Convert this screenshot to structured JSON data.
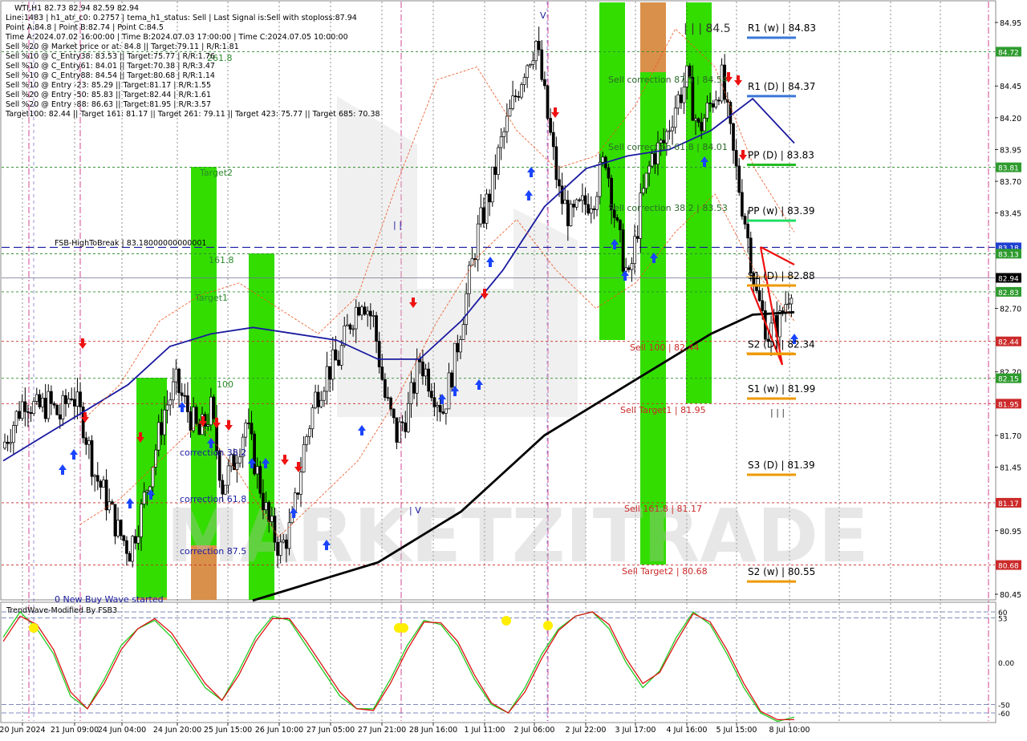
{
  "header": {
    "symbol": "WTI,H1  82.73 82.94 82.59 82.94",
    "lines": [
      "Line:1483 | h1_atr_c0: 0.2757 | tema_h1_status: Sell | Last Signal is:Sell with stoploss:87.94",
      "Point A:84.8 | Point B:82.74 | Point C:84.5",
      "Time A:2024.07.02 16:00:00 | Time B:2024.07.03 17:00:00 | Time C:2024.07.05 10:00:00",
      "Sell %20 @ Market price or at: 84.8 || Target:79.11 | R/R:1.81",
      "Sell %10 @ C_Entry38: 83.53 || Target:75.77 | R/R:1.76",
      "Sell %10 @ C_Entry61: 84.01 || Target:70.38 | R/R:3.47",
      "Sell %10 @ C_Entry88: 84.54 || Target:80.68 | R/R:1.14",
      "Sell %10 @ Entry -23: 85.29 || Target:81.17 | R/R:1.55",
      "Sell %20 @ Entry -50: 85.83 || Target:82.44 | R/R:1.61",
      "Sell %20 @ Entry -88: 86.63 || Target:81.95 | R/R:3.57",
      "Target100: 82.44 || Target 161: 81.17 || Target 261: 79.11 || Target 423: 75.77 || Target 685: 70.38"
    ]
  },
  "watermark": "MARKETZITRADE",
  "colors": {
    "green_zone": "#33dd00",
    "orange_zone": "#d9904a",
    "ma_blue": "#1a1aa0",
    "ma_black": "#000000",
    "bull_candle": "#000000",
    "fsb_line": "#1a1aa0",
    "green_level": "#2e8b2e",
    "red_level": "#cc2a2a",
    "osc_green": "#22cc22",
    "osc_red": "#dd1111"
  },
  "chart_data": [
    {
      "type": "line",
      "title": "",
      "symbol": "WTI",
      "timeframe": "H1",
      "ohlc_last": {
        "open": 82.73,
        "high": 82.94,
        "low": 82.59,
        "close": 82.94
      },
      "x_tick_labels": [
        "20 Jun 2024",
        "21 Jun 09:00",
        "24 Jun 04:00",
        "24 Jun 20:00",
        "25 Jun 15:00",
        "26 Jun 10:00",
        "27 Jun 05:00",
        "27 Jun 21:00",
        "28 Jun 16:00",
        "1 Jul 11:00",
        "2 Jul 06:00",
        "2 Jul 22:00",
        "3 Jul 17:00",
        "4 Jul 16:00",
        "5 Jul 15:00",
        "8 Jul 10:00"
      ],
      "y_tick_labels": [
        "84.95",
        "84.45",
        "84.20",
        "83.95",
        "83.70",
        "83.45",
        "82.70",
        "82.20",
        "81.70",
        "81.45",
        "80.95",
        "80.45"
      ],
      "ylim": [
        80.35,
        85.05
      ],
      "price_series_close": [
        81.6,
        81.8,
        82.0,
        81.9,
        81.95,
        81.85,
        82.05,
        81.8,
        81.4,
        81.2,
        80.95,
        80.8,
        81.1,
        81.5,
        81.9,
        82.1,
        81.9,
        81.7,
        81.9,
        81.3,
        81.5,
        81.8,
        81.4,
        81.0,
        80.8,
        81.0,
        81.6,
        82.0,
        82.2,
        82.3,
        82.6,
        82.8,
        82.6,
        82.0,
        81.7,
        81.9,
        82.3,
        82.1,
        81.9,
        82.3,
        82.8,
        83.3,
        83.6,
        84.0,
        84.3,
        84.6,
        84.8,
        84.2,
        83.6,
        83.4,
        83.5,
        83.6,
        83.9,
        83.3,
        82.9,
        83.5,
        83.9,
        84.0,
        84.3,
        84.5,
        84.1,
        84.3,
        84.5,
        83.9,
        83.4,
        82.8,
        82.5,
        82.6,
        82.9
      ],
      "series": [
        {
          "name": "",
          "role": "moving average (blue)",
          "values": [
            81.5,
            81.7,
            81.9,
            82.1,
            82.4,
            82.5,
            82.55,
            82.5,
            82.45,
            82.3,
            82.3,
            82.6,
            83.0,
            83.5,
            83.8,
            83.9,
            83.95,
            84.1,
            84.35,
            84.0
          ]
        },
        {
          "name": "",
          "role": "moving average (black)",
          "values": [
            80.4,
            80.5,
            80.6,
            80.7,
            80.9,
            81.1,
            81.4,
            81.7,
            81.9,
            82.1,
            82.3,
            82.5,
            82.65,
            82.67
          ]
        }
      ],
      "horizontal_levels": [
        {
          "label": "FSB-HighToBreak | 83.18000000000001",
          "value": 83.18
        },
        {
          "label": "R1 (w) | 84.83",
          "value": 84.83
        },
        {
          "label": "R1 (D) | 84.37",
          "value": 84.37
        },
        {
          "label": "PP (D) | 83.83",
          "value": 83.83
        },
        {
          "label": "PP (w) | 83.39",
          "value": 83.39
        },
        {
          "label": "S1 (D) | 82.88",
          "value": 82.88
        },
        {
          "label": "S2 (D) | 82.34",
          "value": 82.34
        },
        {
          "label": "S1 (w) | 81.99",
          "value": 81.99
        },
        {
          "label": "S3 (D) | 81.39",
          "value": 81.39
        },
        {
          "label": "S2 (w) | 80.55",
          "value": 80.55
        }
      ],
      "zone_labels": [
        "Sell correction 87.5 | 84.54",
        "Sell correction 61.8 | 84.01",
        "Sell correction 38.2 | 83.53",
        "Sell 100 | 82.44",
        "Sell Target1 | 81.95",
        "Sell 161.8 | 81.17",
        "Sell Target2 | 80.68",
        "Target2",
        "Target1",
        "161.8",
        "261.8",
        "100",
        "correction 38.2",
        "correction 61.8",
        "correction 87.5",
        "0 New Buy Wave started",
        "| | | 84.5",
        "| | |",
        "| |",
        "| V",
        "V"
      ],
      "price_axis_tags": [
        {
          "value": 84.72,
          "text": "84.72",
          "kind": "green"
        },
        {
          "value": 83.81,
          "text": "83.81",
          "kind": "green"
        },
        {
          "value": 83.18,
          "text": "83.18",
          "kind": "blue"
        },
        {
          "value": 83.13,
          "text": "83.13",
          "kind": "green"
        },
        {
          "value": 82.94,
          "text": "82.94",
          "kind": "black"
        },
        {
          "value": 82.83,
          "text": "82.83",
          "kind": "green"
        },
        {
          "value": 82.44,
          "text": "82.44",
          "kind": "red"
        },
        {
          "value": 82.15,
          "text": "82.15",
          "kind": "green"
        },
        {
          "value": 81.95,
          "text": "81.95",
          "kind": "red"
        },
        {
          "value": 81.17,
          "text": "81.17",
          "kind": "red"
        },
        {
          "value": 80.68,
          "text": "80.68",
          "kind": "red"
        }
      ]
    },
    {
      "type": "line",
      "title": "TrendWave-Modified By FSB3",
      "y_tick_labels": [
        "60",
        "53",
        "0.00",
        "-50",
        "-60"
      ],
      "ylim": [
        -75,
        75
      ],
      "series": [
        {
          "name": "",
          "color": "green",
          "values": [
            30,
            60,
            40,
            10,
            -40,
            -55,
            -20,
            20,
            40,
            50,
            30,
            0,
            -30,
            -45,
            -10,
            30,
            55,
            50,
            20,
            -10,
            -40,
            -55,
            -55,
            -20,
            20,
            50,
            45,
            20,
            -20,
            -50,
            -60,
            -30,
            10,
            40,
            55,
            60,
            40,
            0,
            -30,
            -10,
            30,
            60,
            45,
            10,
            -30,
            -60,
            -70,
            -65
          ]
        },
        {
          "name": "",
          "color": "red",
          "values": [
            25,
            55,
            45,
            15,
            -35,
            -55,
            -25,
            15,
            40,
            52,
            35,
            5,
            -25,
            -45,
            -15,
            25,
            52,
            52,
            25,
            -5,
            -35,
            -55,
            -57,
            -25,
            15,
            48,
            47,
            25,
            -15,
            -48,
            -60,
            -35,
            5,
            38,
            55,
            60,
            45,
            5,
            -25,
            -12,
            25,
            58,
            48,
            15,
            -25,
            -58,
            -68,
            -68
          ]
        }
      ],
      "signal_dots": [
        "yellow",
        "yellow",
        "yellow",
        "yellow",
        "yellow"
      ]
    }
  ]
}
